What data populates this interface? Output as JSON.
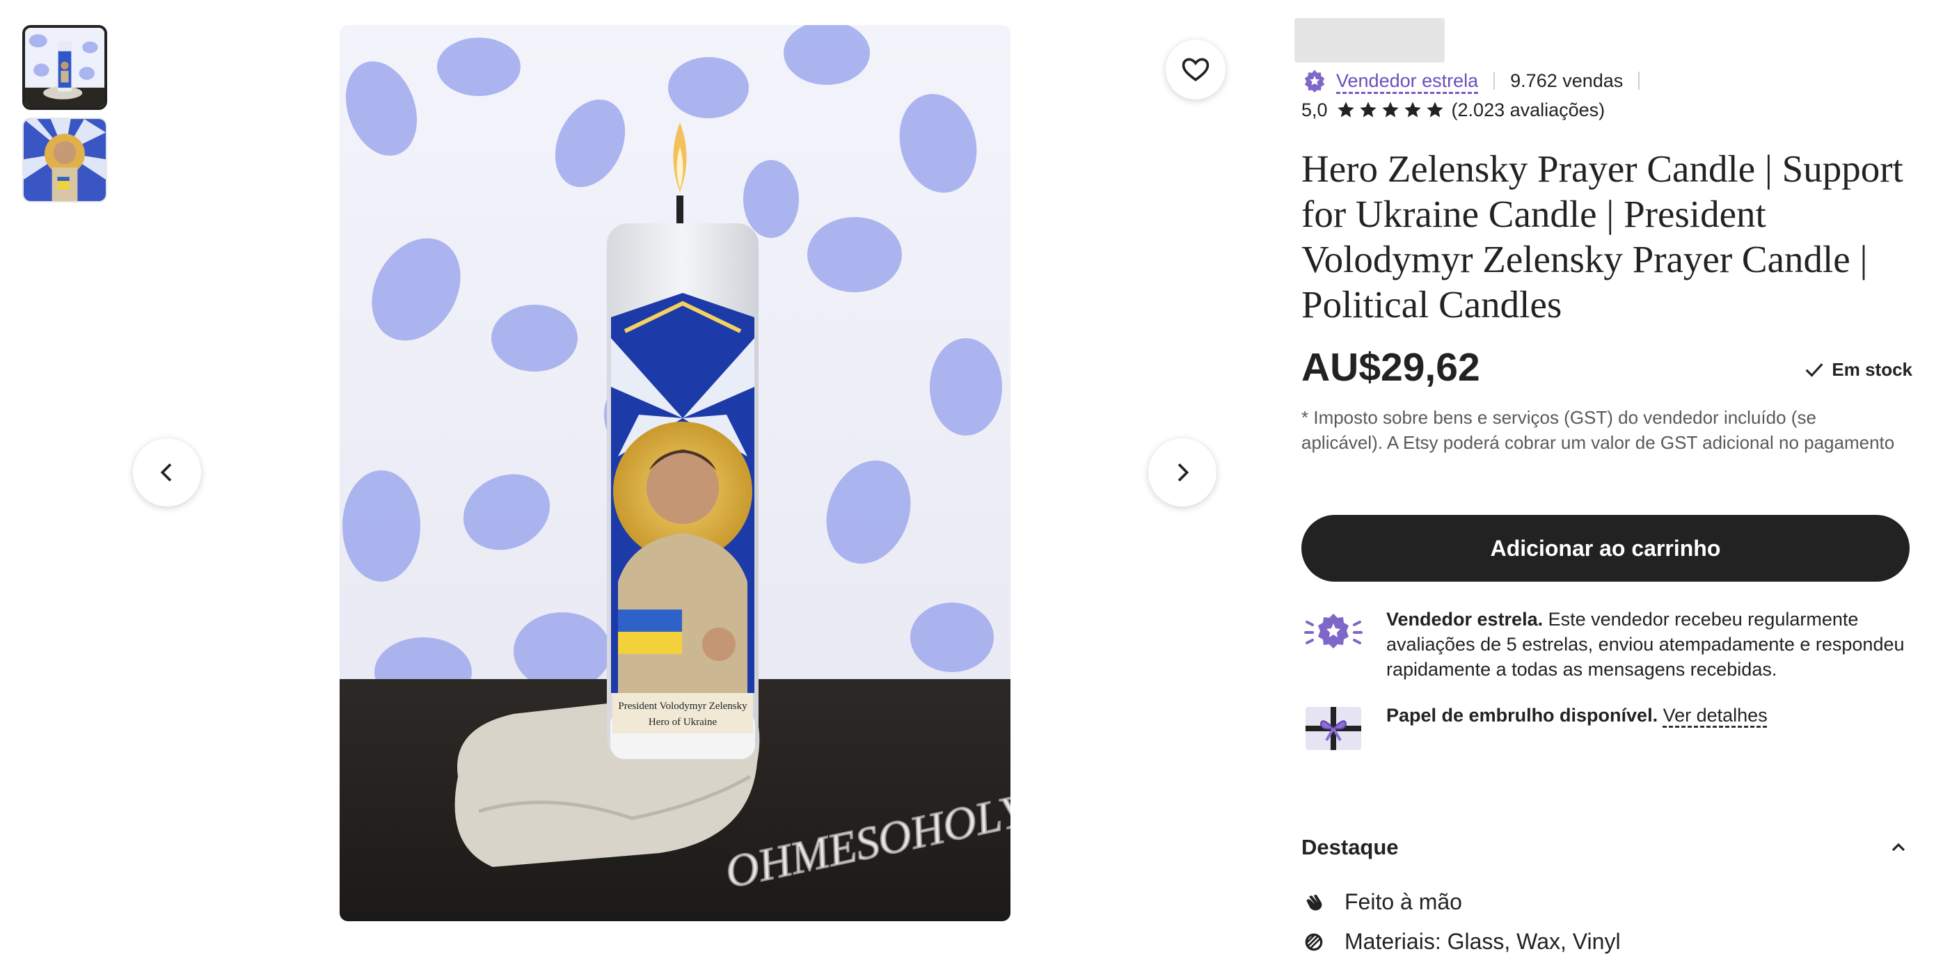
{
  "thumbnails": [
    {
      "name": "thumbnail-candle-on-stone",
      "selected": true
    },
    {
      "name": "thumbnail-candle-closeup",
      "selected": false
    }
  ],
  "main_image": {
    "watermark": "OHMESOHOLY",
    "candle_caption_line1": "President Volodymyr Zelensky",
    "candle_caption_line2": "Hero of Ukraine"
  },
  "seller": {
    "badge_label": "Vendedor estrela",
    "sales": "9.762 vendas"
  },
  "rating": {
    "score": "5,0",
    "stars": 5,
    "reviews": "(2.023 avaliações)"
  },
  "product": {
    "title": "Hero Zelensky Prayer Candle | Support for Ukraine Candle | President Volodymyr Zelensky Prayer Candle | Political Candles",
    "price": "AU$29,62",
    "stock": "Em stock",
    "tax_note": "* Imposto sobre bens e serviços (GST) do vendedor incluído (se aplicável). A Etsy poderá cobrar um valor de GST adicional no pagamento"
  },
  "cart_button": "Adicionar ao carrinho",
  "star_seller_info": {
    "bold": "Vendedor estrela.",
    "text": " Este vendedor recebeu regularmente avaliações de 5 estrelas, enviou atempadamente e respondeu rapidamente a todas as mensagens recebidas."
  },
  "gift_wrap": {
    "bold": "Papel de embrulho disponível.",
    "link": "Ver detalhes"
  },
  "highlights": {
    "title": "Destaque",
    "items": [
      {
        "icon": "hand-icon",
        "text": "Feito à mão"
      },
      {
        "icon": "materials-icon",
        "text": "Materiais: Glass, Wax, Vinyl"
      }
    ]
  },
  "colors": {
    "accent": "#6b4fbb",
    "button": "#222222",
    "text": "#222222",
    "muted": "#595959"
  }
}
